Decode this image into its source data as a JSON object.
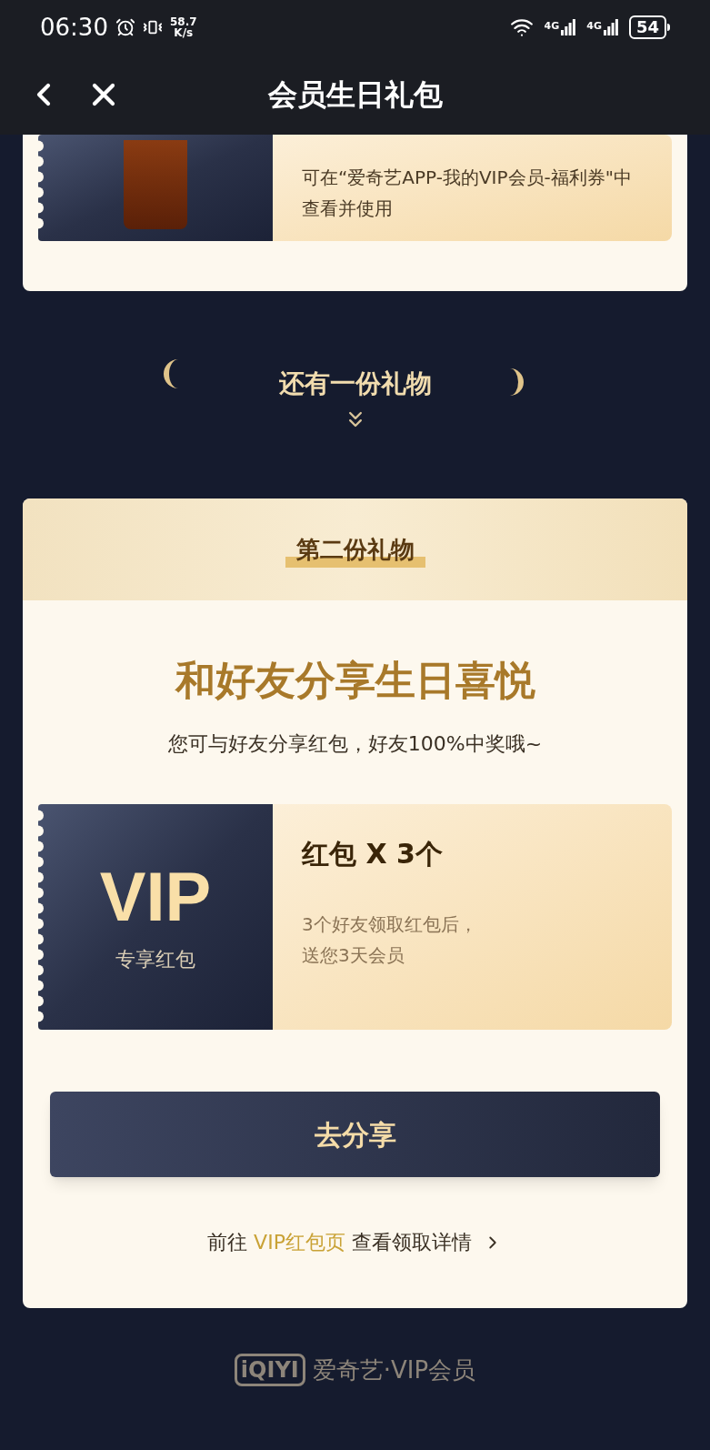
{
  "status_bar": {
    "time": "06:30",
    "net_speed": "58.7",
    "net_unit": "K/s",
    "signal_1": "4G",
    "signal_2": "4G",
    "battery": "54"
  },
  "nav": {
    "title": "会员生日礼包"
  },
  "first_gift": {
    "note": "可在“爱奇艺APP-我的VIP会员-福利券\"中查看并使用"
  },
  "divider": {
    "title": "还有一份礼物"
  },
  "second_gift": {
    "badge": "第二份礼物",
    "heading": "和好友分享生日喜悦",
    "subheading": "您可与好友分享红包，好友100%中奖哦~",
    "coupon": {
      "label_big": "VIP",
      "label_small": "专享红包",
      "title": "红包 X 3个",
      "description": "3个好友领取红包后，送您3天会员"
    },
    "button": "去分享",
    "link_line": {
      "prefix": "前往",
      "link": "VIP红包页",
      "suffix": "查看领取详情"
    }
  },
  "footer": {
    "logo": "iQIYI",
    "brand": "爱奇艺·VIP会员"
  }
}
